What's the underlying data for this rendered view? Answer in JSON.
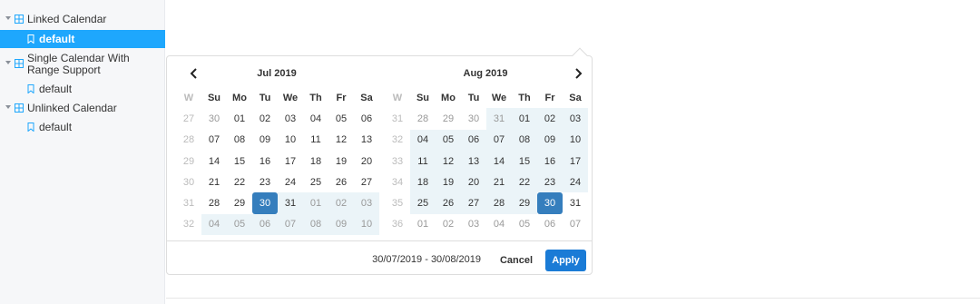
{
  "sidebar": {
    "groups": [
      {
        "label": "Linked Calendar",
        "stories": [
          "default"
        ]
      },
      {
        "label": "Single Calendar With Range Support",
        "label_lines": [
          "Single Calendar With",
          "Range Support"
        ],
        "stories": [
          "default"
        ]
      },
      {
        "label": "Unlinked Calendar",
        "stories": [
          "default"
        ]
      }
    ],
    "selected_story": "Linked Calendar / default"
  },
  "picker": {
    "weekday_headers": [
      "W",
      "Su",
      "Mo",
      "Tu",
      "We",
      "Th",
      "Fr",
      "Sa"
    ],
    "calendars": [
      {
        "month_label": "Jul 2019",
        "weeks": [
          {
            "week": "27",
            "days": [
              "30",
              "01",
              "02",
              "03",
              "04",
              "05",
              "06"
            ]
          },
          {
            "week": "28",
            "days": [
              "07",
              "08",
              "09",
              "10",
              "11",
              "12",
              "13"
            ]
          },
          {
            "week": "29",
            "days": [
              "14",
              "15",
              "16",
              "17",
              "18",
              "19",
              "20"
            ]
          },
          {
            "week": "30",
            "days": [
              "21",
              "22",
              "23",
              "24",
              "25",
              "26",
              "27"
            ]
          },
          {
            "week": "31",
            "days": [
              "28",
              "29",
              "30",
              "31",
              "01",
              "02",
              "03"
            ]
          },
          {
            "week": "32",
            "days": [
              "04",
              "05",
              "06",
              "07",
              "08",
              "09",
              "10"
            ]
          }
        ]
      },
      {
        "month_label": "Aug 2019",
        "weeks": [
          {
            "week": "31",
            "days": [
              "28",
              "29",
              "30",
              "31",
              "01",
              "02",
              "03"
            ]
          },
          {
            "week": "32",
            "days": [
              "04",
              "05",
              "06",
              "07",
              "08",
              "09",
              "10"
            ]
          },
          {
            "week": "33",
            "days": [
              "11",
              "12",
              "13",
              "14",
              "15",
              "16",
              "17"
            ]
          },
          {
            "week": "34",
            "days": [
              "18",
              "19",
              "20",
              "21",
              "22",
              "23",
              "24"
            ]
          },
          {
            "week": "35",
            "days": [
              "25",
              "26",
              "27",
              "28",
              "29",
              "30",
              "31"
            ]
          },
          {
            "week": "36",
            "days": [
              "01",
              "02",
              "03",
              "04",
              "05",
              "06",
              "07"
            ]
          }
        ]
      }
    ],
    "selection": {
      "start": "30/07/2019",
      "end": "30/08/2019"
    },
    "range_text": "30/07/2019 - 30/08/2019",
    "cancel_label": "Cancel",
    "apply_label": "Apply"
  },
  "colors": {
    "sidebar_selected": "#1ea7fd",
    "active_day": "#357ebd",
    "in_range": "#ebf4f8",
    "apply_button": "#1a7bd6"
  }
}
